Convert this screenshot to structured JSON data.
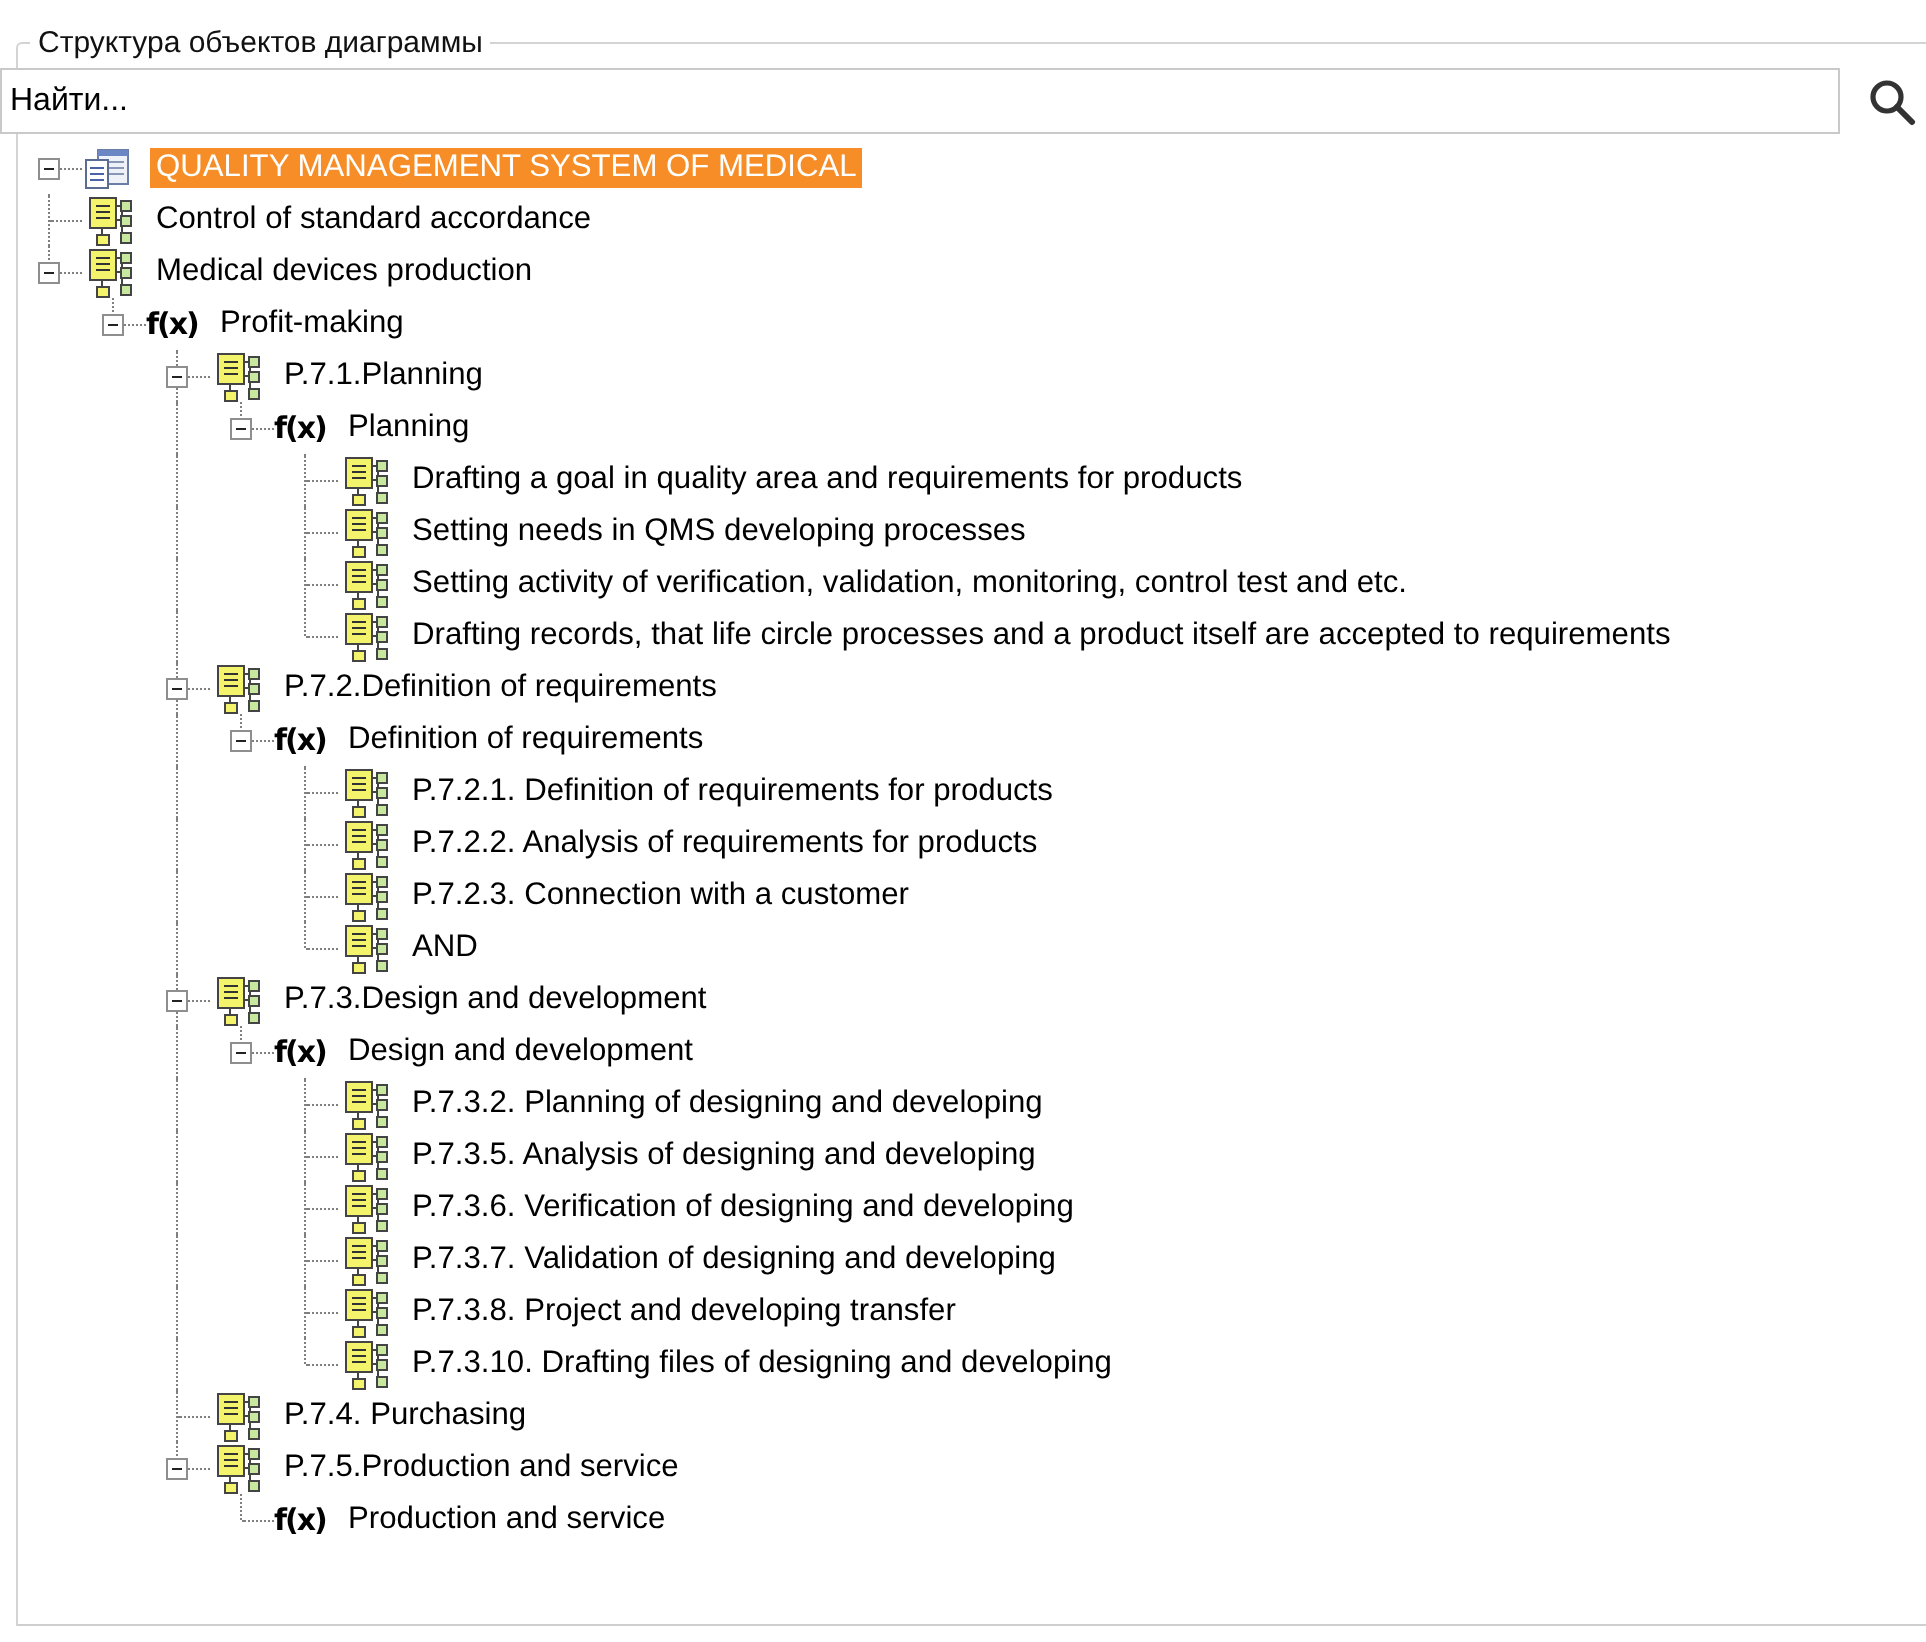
{
  "group_title": "Структура объектов диаграммы",
  "search": {
    "placeholder": "Найти..."
  },
  "tree": [
    {
      "kind": "document",
      "label": "QUALITY MANAGEMENT SYSTEM OF MEDICAL",
      "selected": true,
      "expanded": true,
      "children": [
        {
          "kind": "process",
          "label": "Control of standard accordance",
          "selected": false
        },
        {
          "kind": "process",
          "label": "Medical devices production",
          "selected": false,
          "expanded": true,
          "children": [
            {
              "kind": "function",
              "glyph": "f(x)",
              "label": "Profit-making",
              "selected": false,
              "expanded": true,
              "children": [
                {
                  "kind": "process",
                  "label": "P.7.1.Planning",
                  "selected": false,
                  "expanded": true,
                  "children": [
                    {
                      "kind": "function",
                      "glyph": "f(x)",
                      "label": "Planning",
                      "selected": false,
                      "expanded": true,
                      "children": [
                        {
                          "kind": "process",
                          "label": "Drafting a goal in quality area and requirements for products",
                          "selected": false
                        },
                        {
                          "kind": "process",
                          "label": "Setting needs in QMS developing processes",
                          "selected": false
                        },
                        {
                          "kind": "process",
                          "label": "Setting activity of verification, validation, monitoring, control test and etc.",
                          "selected": false
                        },
                        {
                          "kind": "process",
                          "label": "Drafting records, that life circle processes and a product itself are accepted to requirements",
                          "selected": false
                        }
                      ]
                    }
                  ]
                },
                {
                  "kind": "process",
                  "label": "P.7.2.Definition of requirements",
                  "selected": false,
                  "expanded": true,
                  "children": [
                    {
                      "kind": "function",
                      "glyph": "f(x)",
                      "label": "Definition of requirements",
                      "selected": false,
                      "expanded": true,
                      "children": [
                        {
                          "kind": "process",
                          "label": "P.7.2.1. Definition of requirements for products",
                          "selected": false
                        },
                        {
                          "kind": "process",
                          "label": "P.7.2.2. Analysis of requirements for products",
                          "selected": false
                        },
                        {
                          "kind": "process",
                          "label": "P.7.2.3. Connection with a customer",
                          "selected": false
                        },
                        {
                          "kind": "process",
                          "label": "AND",
                          "selected": false
                        }
                      ]
                    }
                  ]
                },
                {
                  "kind": "process",
                  "label": "P.7.3.Design and development",
                  "selected": false,
                  "expanded": true,
                  "children": [
                    {
                      "kind": "function",
                      "glyph": "f(x)",
                      "label": "Design and development",
                      "selected": false,
                      "expanded": true,
                      "children": [
                        {
                          "kind": "process",
                          "label": "P.7.3.2. Planning of designing and developing",
                          "selected": false
                        },
                        {
                          "kind": "process",
                          "label": "P.7.3.5. Analysis of designing and developing",
                          "selected": false
                        },
                        {
                          "kind": "process",
                          "label": "P.7.3.6. Verification of designing and developing",
                          "selected": false
                        },
                        {
                          "kind": "process",
                          "label": "P.7.3.7. Validation of designing and developing",
                          "selected": false
                        },
                        {
                          "kind": "process",
                          "label": "P.7.3.8. Project and developing transfer",
                          "selected": false
                        },
                        {
                          "kind": "process",
                          "label": "P.7.3.10. Drafting files of designing and developing",
                          "selected": false
                        }
                      ]
                    }
                  ]
                },
                {
                  "kind": "process",
                  "label": "P.7.4. Purchasing",
                  "selected": false
                },
                {
                  "kind": "process",
                  "label": "P.7.5.Production and service",
                  "selected": false,
                  "expanded": true,
                  "children": [
                    {
                      "kind": "function",
                      "glyph": "f(x)",
                      "label": "Production and service",
                      "selected": false
                    }
                  ]
                }
              ]
            }
          ]
        }
      ]
    }
  ]
}
